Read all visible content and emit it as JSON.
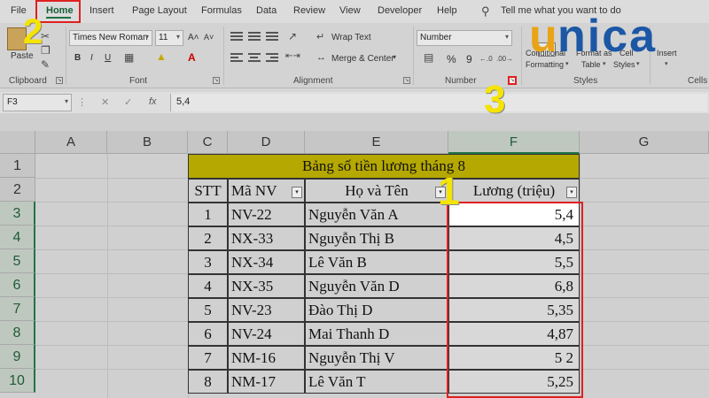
{
  "menu": {
    "tabs": [
      {
        "label": "File"
      },
      {
        "label": "Home"
      },
      {
        "label": "Insert"
      },
      {
        "label": "Page Layout"
      },
      {
        "label": "Formulas"
      },
      {
        "label": "Data"
      },
      {
        "label": "Review"
      },
      {
        "label": "View"
      },
      {
        "label": "Developer"
      },
      {
        "label": "Help"
      }
    ],
    "tell_me": "Tell me what you want to do"
  },
  "ribbon": {
    "clipboard": {
      "label": "Clipboard",
      "paste_label": "Paste"
    },
    "font": {
      "label": "Font",
      "family": "Times New Roman",
      "size": "11",
      "bold": "B",
      "italic": "I",
      "underline": "U"
    },
    "alignment": {
      "label": "Alignment",
      "wrap_text": "Wrap Text",
      "merge_center": "Merge & Center"
    },
    "number": {
      "label": "Number",
      "format": "Number",
      "percent": "%",
      "comma": "9"
    },
    "styles": {
      "label": "Styles",
      "conditional_1": "Conditional",
      "conditional_2": "Formatting",
      "format_as_1": "Format as",
      "format_as_2": "Table",
      "cell_styles_1": "Cell",
      "cell_styles_2": "Styles"
    },
    "cells": {
      "label": "Cells",
      "insert": "Insert"
    }
  },
  "formula_bar": {
    "name_box": "F3",
    "fx": "fx",
    "value": "5,4"
  },
  "columns": [
    "A",
    "B",
    "C",
    "D",
    "E",
    "F",
    "G"
  ],
  "rows": [
    "1",
    "2",
    "3",
    "4",
    "5",
    "6",
    "7",
    "8",
    "9",
    "10"
  ],
  "sheet": {
    "title": "Bảng số tiền lương tháng 8",
    "headers": {
      "stt": "STT",
      "ma_nv": "Mã NV",
      "ho_ten": "Họ và Tên",
      "luong": "Lương (triệu)"
    },
    "data": [
      {
        "stt": "1",
        "ma": "NV-22",
        "ten": "Nguyễn Văn A",
        "luong": "5,4"
      },
      {
        "stt": "2",
        "ma": "NX-33",
        "ten": "Nguyễn Thị B",
        "luong": "4,5"
      },
      {
        "stt": "3",
        "ma": "NX-34",
        "ten": "Lê Văn B",
        "luong": "5,5"
      },
      {
        "stt": "4",
        "ma": "NX-35",
        "ten": "Nguyễn Văn D",
        "luong": "6,8"
      },
      {
        "stt": "5",
        "ma": "NV-23",
        "ten": "Đào Thị D",
        "luong": "5,35"
      },
      {
        "stt": "6",
        "ma": "NV-24",
        "ten": "Mai Thanh D",
        "luong": "4,87"
      },
      {
        "stt": "7",
        "ma": "NM-16",
        "ten": "Nguyễn Thị V",
        "luong": "5 2"
      },
      {
        "stt": "8",
        "ma": "NM-17",
        "ten": "Lê Văn T",
        "luong": "5,25"
      }
    ]
  },
  "annotations": {
    "step1": "1",
    "step2": "2",
    "step3": "3"
  },
  "logo": {
    "text": "unica",
    "color_u": "#e8a317",
    "color_rest": "#1c57a6"
  },
  "colors": {
    "accent": "#217346",
    "highlight_red": "#e02020",
    "title_fill": "#b5a800",
    "badge_yellow": "#f5e400"
  }
}
